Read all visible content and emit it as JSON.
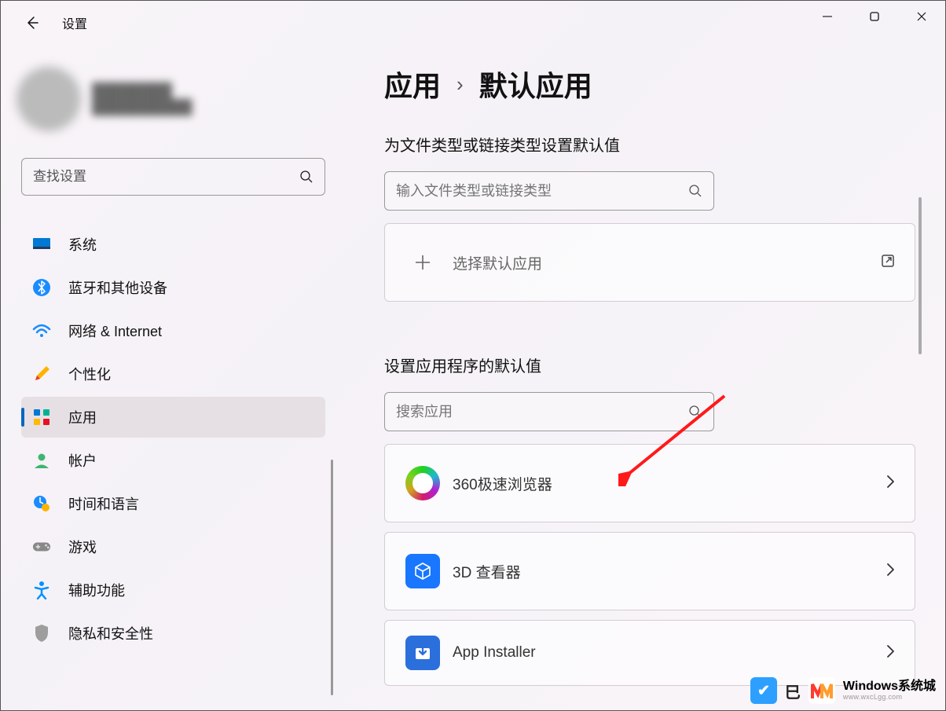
{
  "window": {
    "title": "设置"
  },
  "search": {
    "placeholder": "查找设置"
  },
  "nav": {
    "items": [
      {
        "key": "system",
        "label": "系统"
      },
      {
        "key": "bluetooth",
        "label": "蓝牙和其他设备"
      },
      {
        "key": "network",
        "label": "网络 & Internet"
      },
      {
        "key": "personalization",
        "label": "个性化"
      },
      {
        "key": "apps",
        "label": "应用"
      },
      {
        "key": "accounts",
        "label": "帐户"
      },
      {
        "key": "time",
        "label": "时间和语言"
      },
      {
        "key": "gaming",
        "label": "游戏"
      },
      {
        "key": "accessibility",
        "label": "辅助功能"
      },
      {
        "key": "privacy",
        "label": "隐私和安全性"
      }
    ]
  },
  "breadcrumb": {
    "parent": "应用",
    "sep": "›",
    "current": "默认应用"
  },
  "filetype": {
    "header": "为文件类型或链接类型设置默认值",
    "placeholder": "输入文件类型或链接类型",
    "choose_label": "选择默认应用"
  },
  "appdefaults": {
    "header": "设置应用程序的默认值",
    "placeholder": "搜索应用",
    "apps": [
      {
        "key": "360",
        "label": "360极速浏览器"
      },
      {
        "key": "3dviewer",
        "label": "3D 查看器"
      },
      {
        "key": "appinstaller",
        "label": "App Installer"
      }
    ]
  },
  "watermark": {
    "title": "Windows系统城",
    "url": "www.wxcLgg.com"
  }
}
